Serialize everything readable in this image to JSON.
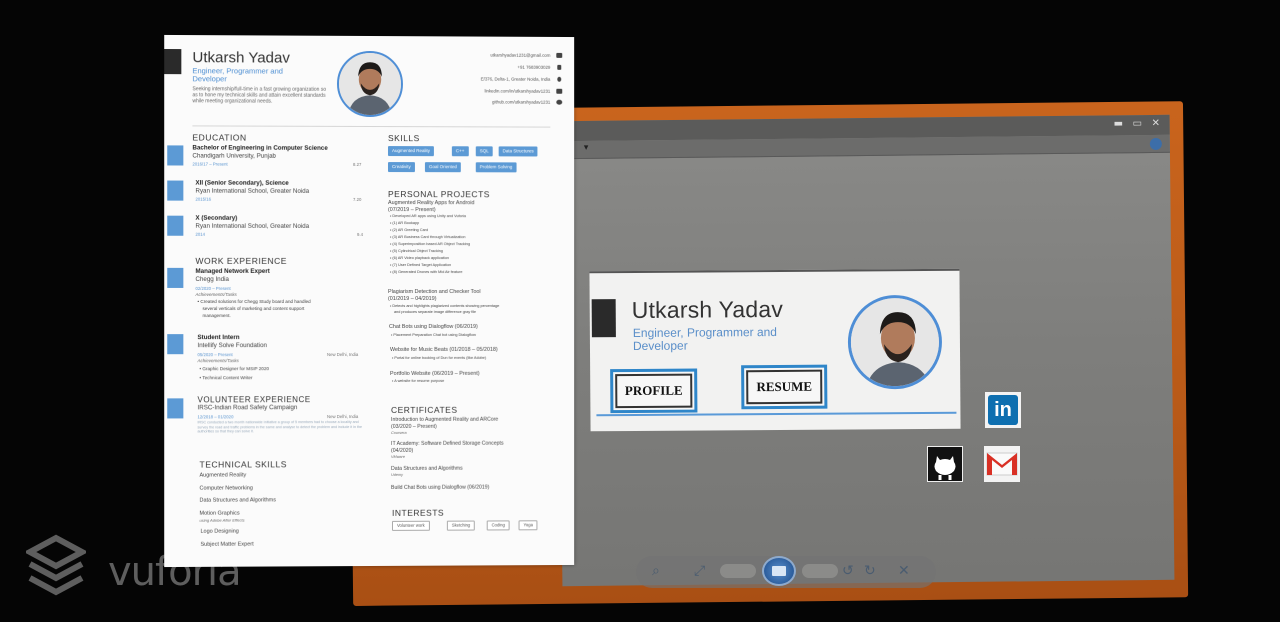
{
  "resume": {
    "name": "Utkarsh Yadav",
    "subtitle": "Engineer, Programmer and Developer",
    "summary": "Seeking internship/full-time in a fast growing organization so as to hone my technical skills and attain excellent standards while meeting organizational needs.",
    "contacts": [
      {
        "text": "utkarshyadav1231@gmail.com",
        "icon": "email-icon"
      },
      {
        "text": "+91 7683903029",
        "icon": "phone-icon"
      },
      {
        "text": "E/376, Delta-1, Greater Noida, India",
        "icon": "location-icon"
      },
      {
        "text": "linkedin.com/in/utkarshyadav1231",
        "icon": "linkedin-small-icon"
      },
      {
        "text": "github.com/utkarshyadav1231",
        "icon": "github-small-icon"
      }
    ],
    "education": {
      "heading": "EDUCATION",
      "items": [
        {
          "title": "Bachelor of Engineering in Computer Science",
          "school": "Chandigarh University, Punjab",
          "date": "2016/17 – Present",
          "right": "8.27"
        },
        {
          "title": "XII (Senior Secondary), Science",
          "school": "Ryan International School, Greater Noida",
          "date": "2015/16",
          "right": "7.20"
        },
        {
          "title": "X (Secondary)",
          "school": "Ryan International School, Greater Noida",
          "date": "2014",
          "right": "9.4"
        }
      ]
    },
    "work": {
      "heading": "WORK EXPERIENCE",
      "items": [
        {
          "title": "Managed Network Expert",
          "org": "Chegg India",
          "date": "02/2020 – Present",
          "sub": "Achievements/Tasks",
          "bullets": [
            "Created solutions for Chegg Study board and handled",
            "several verticals of marketing and content support",
            "management."
          ],
          "right": ""
        },
        {
          "title": "Student Intern",
          "org": "Intellify Solve Foundation",
          "date": "05/2020 – Present",
          "sub": "Achievements/Tasks",
          "bullets": [
            "Graphic Designer for MSIP 2020",
            "Technical Content Writer"
          ],
          "right": "New Delhi, India"
        }
      ]
    },
    "volunteer": {
      "heading": "VOLUNTEER EXPERIENCE",
      "title": "IRSC-Indian Road Safety Campaign",
      "date": "12/2018 – 01/2020",
      "right": "New Delhi, India",
      "text": "IRSC conducted a two month nationwide initiative a group of 5 members had to choose a locality and survey the road and traffic problems in the same and analyse to detect the problem and include it in the authorities so that they can solve it."
    },
    "technical": {
      "heading": "TECHNICAL SKILLS",
      "items": [
        "Augmented Reality",
        "Computer Networking",
        "Data Structures and Algorithms",
        "Motion Graphics",
        "Logo Designing",
        "Subject Matter Expert"
      ],
      "motion_note": "using Adobe After Effects"
    },
    "skills": {
      "heading": "SKILLS",
      "tags": [
        "Augmented Reality",
        "C++",
        "SQL",
        "Data Structures",
        "Creativity",
        "Goal Oriented",
        "Problem Solving"
      ]
    },
    "projects": {
      "heading": "PERSONAL PROJECTS",
      "items": [
        {
          "title": "Augmented Reality Apps for Android",
          "date": "(07/2019 – Present)",
          "bullets": [
            "Developed AR apps using Unity and Vuforia",
            "(1) AR Bookapp",
            "(2) AR Greeting Card",
            "(3) AR Business Card through Virtualization",
            "(4) Superimposition based AR Object Tracking",
            "(5) Cylindrical Object Tracking",
            "(6) AR Video playback application",
            "(7) User Defined Target Application",
            "(8) Generated Drones with Mid Air feature"
          ]
        },
        {
          "title": "Plagiarism Detection and Checker Tool",
          "date": "(01/2019 – 04/2019)",
          "bullets": [
            "Detects and highlights plagiarized contents showing percentage",
            "and produces separate image difference gray file"
          ]
        },
        {
          "title": "Chat Bots using Dialogflow (06/2019)",
          "date": "",
          "bullets": [
            "Placement Preparation Chat bot using Dialogflow"
          ]
        },
        {
          "title": "Website for Music Beats (01/2018 – 05/2018)",
          "date": "",
          "bullets": [
            "Portal for online booking of Dun for events (like Adobe)"
          ]
        },
        {
          "title": "Portfolio Website (06/2019 – Present)",
          "date": "",
          "bullets": [
            "A website for resume purpose"
          ]
        }
      ]
    },
    "certificates": {
      "heading": "CERTIFICATES",
      "items": [
        {
          "title": "Introduction to Augmented Reality and ARCore",
          "date": "(03/2020 – Present)",
          "issuer": "Coursera"
        },
        {
          "title": "IT Academy: Software Defined Storage Concepts",
          "date": "(04/2020)",
          "issuer": "VMware"
        },
        {
          "title": "Data Structures and Algorithms",
          "date": "",
          "issuer": "Udemy"
        },
        {
          "title": "Build Chat Bots using Dialogflow (06/2019)",
          "date": "",
          "issuer": ""
        }
      ]
    },
    "interests": {
      "heading": "INTERESTS",
      "tags": [
        "Volunteer work",
        "Sketching",
        "Coding",
        "Yoga"
      ]
    }
  },
  "slide": {
    "name": "Utkarsh Yadav",
    "subtitle": "Engineer, Programmer and Developer",
    "profile_label": "PROFILE",
    "resume_label": "RESUME"
  },
  "social": {
    "linkedin_text": "in",
    "gmail_text": "M"
  },
  "watermark": {
    "text": "vuforia"
  },
  "colors": {
    "accent": "#4e8ed6",
    "monitor_frame": "#c9641d",
    "linkedin": "#0e6fb0",
    "gmail": "#d93025"
  }
}
